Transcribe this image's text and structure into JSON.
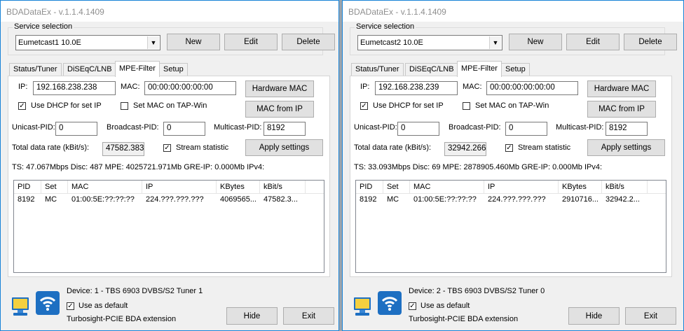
{
  "windows": [
    {
      "title": "BDADataEx - v.1.1.4.1409",
      "service_group_label": "Service selection",
      "service_value": "Eumetcast1 10.0E",
      "buttons": {
        "new": "New",
        "edit": "Edit",
        "delete": "Delete",
        "hardware_mac": "Hardware MAC",
        "mac_from_ip": "MAC from IP",
        "apply": "Apply settings",
        "hide": "Hide",
        "exit": "Exit"
      },
      "tabs": [
        "Status/Tuner",
        "DiSEqC/LNB",
        "MPE-Filter",
        "Setup"
      ],
      "ip_label": "IP:",
      "ip_value": "192.168.238.238",
      "mac_label": "MAC:",
      "mac_value": "00:00:00:00:00:00",
      "dhcp_label": "Use DHCP for set IP",
      "dhcp_checked": true,
      "setmac_label": "Set MAC on TAP-Win",
      "setmac_checked": false,
      "unicast_label": "Unicast-PID:",
      "unicast_value": "0",
      "broadcast_label": "Broadcast-PID:",
      "broadcast_value": "0",
      "multicast_label": "Multicast-PID:",
      "multicast_value": "8192",
      "rate_label": "Total data rate (kBit/s):",
      "rate_value": "47582.383",
      "stream_label": "Stream statistic",
      "stream_checked": true,
      "status_line": "TS: 47.067Mbps   Disc: 487   MPE: 4025721.971Mb   GRE-IP: 0.000Mb   IPv4:",
      "columns": [
        "PID",
        "Set",
        "MAC",
        "IP",
        "KBytes",
        "kBit/s"
      ],
      "rows": [
        [
          "8192",
          "MC",
          "01:00:5E:??:??:??",
          "224.???.???.???",
          "4069565...",
          "47582.3..."
        ]
      ],
      "device_label": "Device: 1 - TBS 6903 DVBS/S2 Tuner 1",
      "default_label": "Use as default",
      "default_checked": true,
      "extension_label": "Turbosight-PCIE BDA extension"
    },
    {
      "title": "BDADataEx - v.1.1.4.1409",
      "service_group_label": "Service selection",
      "service_value": "Eumetcast2 10.0E",
      "buttons": {
        "new": "New",
        "edit": "Edit",
        "delete": "Delete",
        "hardware_mac": "Hardware MAC",
        "mac_from_ip": "MAC from IP",
        "apply": "Apply settings",
        "hide": "Hide",
        "exit": "Exit"
      },
      "tabs": [
        "Status/Tuner",
        "DiSEqC/LNB",
        "MPE-Filter",
        "Setup"
      ],
      "ip_label": "IP:",
      "ip_value": "192.168.238.239",
      "mac_label": "MAC:",
      "mac_value": "00:00:00:00:00:00",
      "dhcp_label": "Use DHCP for set IP",
      "dhcp_checked": true,
      "setmac_label": "Set MAC on TAP-Win",
      "setmac_checked": false,
      "unicast_label": "Unicast-PID:",
      "unicast_value": "0",
      "broadcast_label": "Broadcast-PID:",
      "broadcast_value": "0",
      "multicast_label": "Multicast-PID:",
      "multicast_value": "8192",
      "rate_label": "Total data rate (kBit/s):",
      "rate_value": "32942.266",
      "stream_label": "Stream statistic",
      "stream_checked": true,
      "status_line": "TS: 33.093Mbps   Disc: 69   MPE: 2878905.460Mb   GRE-IP: 0.000Mb   IPv4:",
      "columns": [
        "PID",
        "Set",
        "MAC",
        "IP",
        "KBytes",
        "kBit/s"
      ],
      "rows": [
        [
          "8192",
          "MC",
          "01:00:5E:??:??:??",
          "224.???.???.???",
          "2910716...",
          "32942.2..."
        ]
      ],
      "device_label": "Device: 2 - TBS 6903 DVBS/S2 Tuner 0",
      "default_label": "Use as default",
      "default_checked": true,
      "extension_label": "Turbosight-PCIE BDA extension"
    }
  ],
  "colors": {
    "window_border": "#1883d7",
    "desktop": "#9aa4ad",
    "icon_blue": "#1d6fc2"
  },
  "icons": {
    "check": "✓",
    "dropdown": "▼",
    "device": "monitor-icon",
    "network": "wifi-icon"
  }
}
